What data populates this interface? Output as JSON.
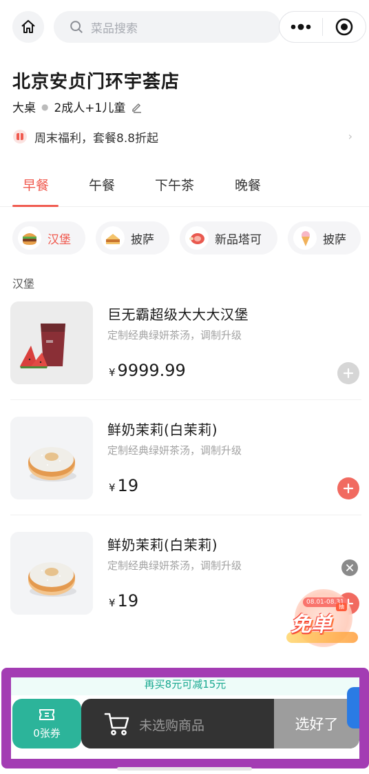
{
  "header": {
    "search_placeholder": "菜品搜索"
  },
  "store": {
    "name": "北京安贞门环宇荟店",
    "table_type": "大桌",
    "guests": "2成人+1儿童",
    "promo": "周末福利，套餐8.8折起"
  },
  "meal_tabs": [
    {
      "label": "早餐",
      "active": true
    },
    {
      "label": "午餐",
      "active": false
    },
    {
      "label": "下午茶",
      "active": false
    },
    {
      "label": "晚餐",
      "active": false
    }
  ],
  "categories": [
    {
      "label": "汉堡",
      "icon": "burger-icon",
      "active": true
    },
    {
      "label": "披萨",
      "icon": "sandwich-icon",
      "active": false
    },
    {
      "label": "新品塔可",
      "icon": "ham-icon",
      "active": false
    },
    {
      "label": "披萨",
      "icon": "ice-cream-icon",
      "active": false
    }
  ],
  "section_title": "汉堡",
  "products": [
    {
      "name": "巨无霸超级大大大汉堡",
      "desc": "定制经典绿妍茶汤，调制升级",
      "currency": "¥",
      "price": "9999.99",
      "image": "watermelon-drink",
      "add_enabled": false
    },
    {
      "name": "鲜奶茉莉(白茉莉)",
      "desc": "定制经典绿妍茶汤，调制升级",
      "currency": "¥",
      "price": "19",
      "image": "donut",
      "add_enabled": true
    },
    {
      "name": "鲜奶茉莉(白茉莉)",
      "desc": "定制经典绿妍茶汤，调制升级",
      "currency": "¥",
      "price": "19",
      "image": "donut",
      "add_enabled": true
    }
  ],
  "free_badge": {
    "date": "08.01-08.31",
    "text": "免单",
    "tag": "抽"
  },
  "bottom_bar": {
    "notice": "再买8元可减15元",
    "coupon_count": "0张券",
    "cart_empty": "未选购商品",
    "checkout": "选好了"
  },
  "colors": {
    "accent": "#f05a4f",
    "teal": "#2cb49a",
    "highlight": "#a33cb3"
  }
}
